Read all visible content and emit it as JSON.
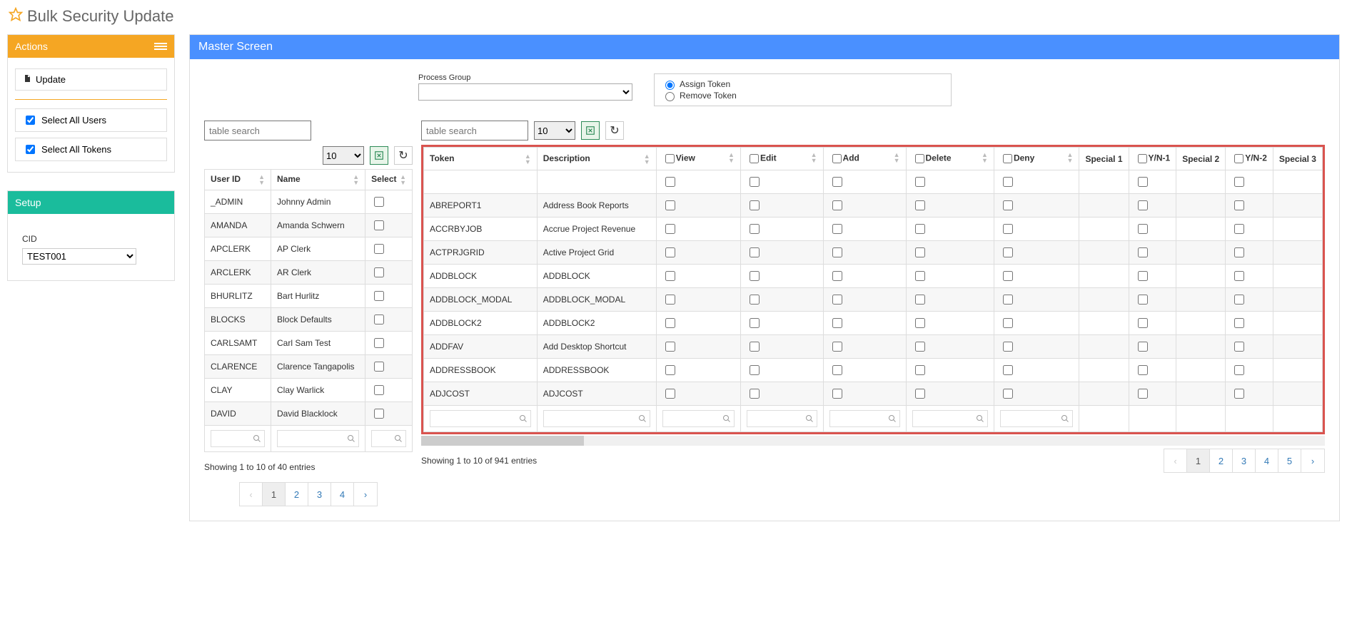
{
  "page_title": "Bulk Security Update",
  "actions_panel": {
    "title": "Actions",
    "update_label": "Update",
    "select_all_users_label": "Select All Users",
    "select_all_tokens_label": "Select All Tokens"
  },
  "setup_panel": {
    "title": "Setup",
    "cid_label": "CID",
    "cid_value": "TEST001"
  },
  "master": {
    "title": "Master Screen",
    "process_group_label": "Process Group",
    "assign_token_label": "Assign Token",
    "remove_token_label": "Remove Token",
    "table_search_placeholder": "table search",
    "page_length": "10"
  },
  "user_table": {
    "headers": {
      "user_id": "User ID",
      "name": "Name",
      "select": "Select"
    },
    "rows": [
      {
        "id": "_ADMIN",
        "name": "Johnny Admin"
      },
      {
        "id": "AMANDA",
        "name": "Amanda Schwern"
      },
      {
        "id": "APCLERK",
        "name": "AP Clerk"
      },
      {
        "id": "ARCLERK",
        "name": "AR Clerk"
      },
      {
        "id": "BHURLITZ",
        "name": "Bart Hurlitz"
      },
      {
        "id": "BLOCKS",
        "name": "Block Defaults"
      },
      {
        "id": "CARLSAMT",
        "name": "Carl Sam Test"
      },
      {
        "id": "CLARENCE",
        "name": "Clarence Tangapolis"
      },
      {
        "id": "CLAY",
        "name": "Clay Warlick"
      },
      {
        "id": "DAVID",
        "name": "David Blacklock"
      }
    ],
    "info": "Showing 1 to 10 of 40 entries",
    "pages": [
      "1",
      "2",
      "3",
      "4"
    ]
  },
  "token_table": {
    "headers": {
      "token": "Token",
      "description": "Description",
      "view": "View",
      "edit": "Edit",
      "add": "Add",
      "delete": "Delete",
      "deny": "Deny",
      "special1": "Special 1",
      "yn1": "Y/N-1",
      "special2": "Special 2",
      "yn2": "Y/N-2",
      "special3": "Special 3"
    },
    "rows": [
      {
        "token": "",
        "desc": ""
      },
      {
        "token": "ABREPORT1",
        "desc": "Address Book Reports"
      },
      {
        "token": "ACCRBYJOB",
        "desc": "Accrue Project Revenue"
      },
      {
        "token": "ACTPRJGRID",
        "desc": "Active Project Grid"
      },
      {
        "token": "ADDBLOCK",
        "desc": "ADDBLOCK"
      },
      {
        "token": "ADDBLOCK_MODAL",
        "desc": "ADDBLOCK_MODAL"
      },
      {
        "token": "ADDBLOCK2",
        "desc": "ADDBLOCK2"
      },
      {
        "token": "ADDFAV",
        "desc": "Add Desktop Shortcut"
      },
      {
        "token": "ADDRESSBOOK",
        "desc": "ADDRESSBOOK"
      },
      {
        "token": "ADJCOST",
        "desc": "ADJCOST"
      }
    ],
    "info": "Showing 1 to 10 of 941 entries",
    "pages": [
      "1",
      "2",
      "3",
      "4",
      "5"
    ]
  }
}
